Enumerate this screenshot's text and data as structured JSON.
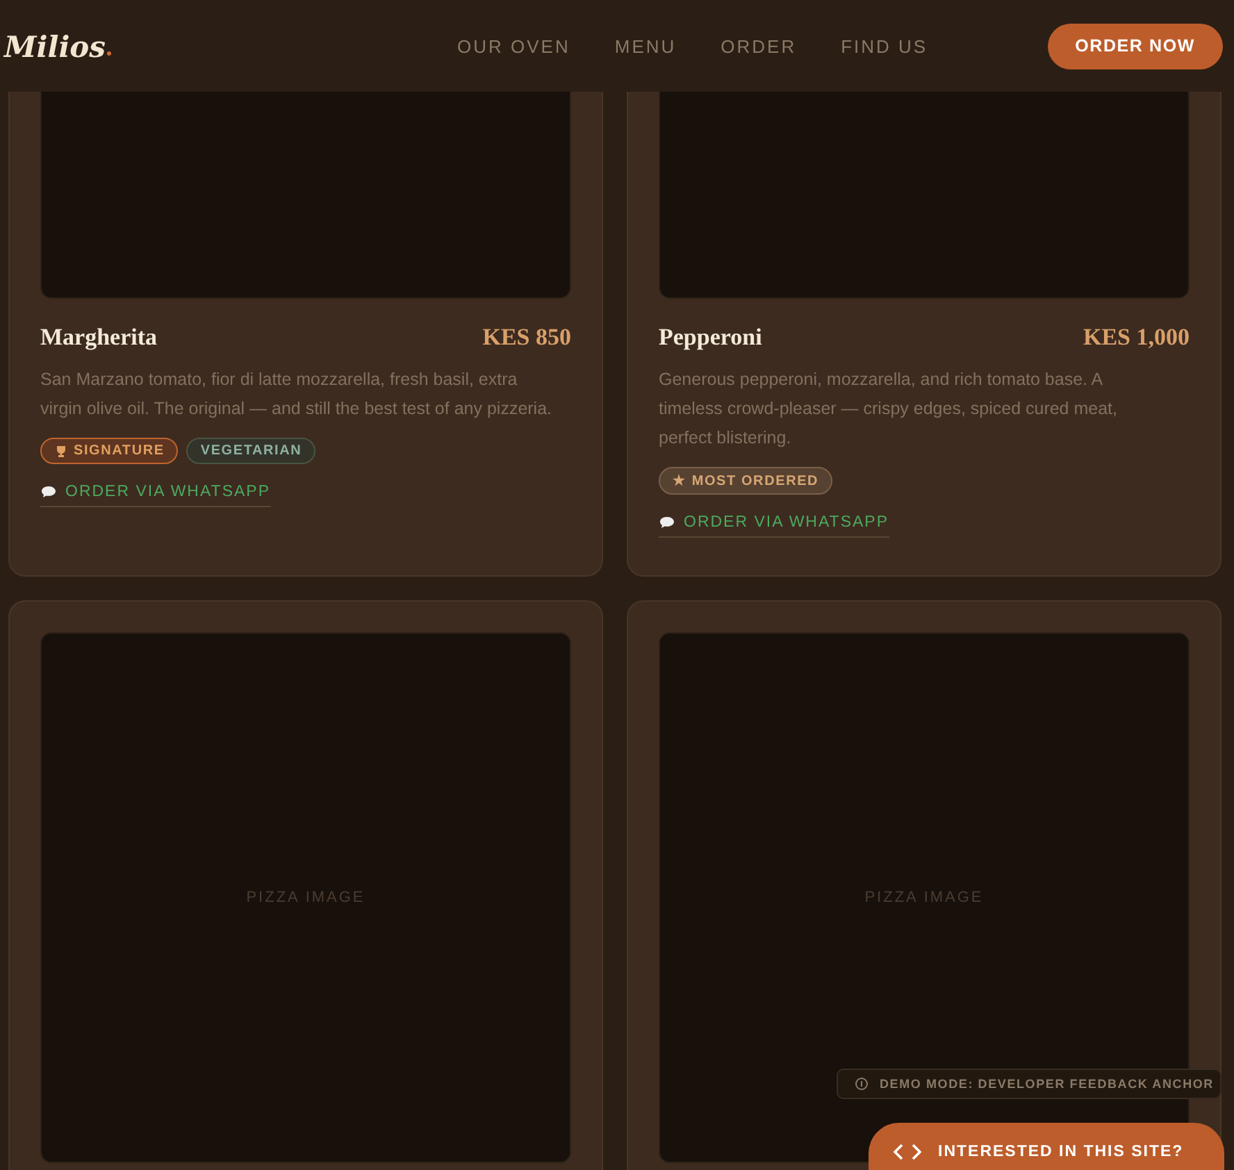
{
  "header": {
    "logo": "Milios",
    "nav": [
      {
        "label": "OUR OVEN"
      },
      {
        "label": "MENU"
      },
      {
        "label": "ORDER"
      },
      {
        "label": "FIND US"
      }
    ],
    "cta": "ORDER NOW"
  },
  "cards": [
    {
      "name": "Margherita",
      "price": "KES 850",
      "description": "San Marzano tomato, fior di latte mozzarella, fresh basil, extra virgin olive oil. The original — and still the best test of any pizzeria.",
      "tags": [
        {
          "kind": "signature",
          "label": "SIGNATURE"
        },
        {
          "kind": "vegetarian",
          "label": "VEGETARIAN"
        }
      ],
      "order_link": "ORDER VIA WHATSAPP"
    },
    {
      "name": "Pepperoni",
      "price": "KES 1,000",
      "description": "Generous pepperoni, mozzarella, and rich tomato base. A timeless crowd-pleaser — crispy edges, spiced cured meat, perfect blistering.",
      "tags": [
        {
          "kind": "popular",
          "label": "MOST ORDERED",
          "icon": "★"
        }
      ],
      "order_link": "ORDER VIA WHATSAPP"
    },
    {
      "image_label": "PIZZA IMAGE"
    },
    {
      "image_label": "PIZZA IMAGE"
    }
  ],
  "demo_notice": "DEMO MODE: DEVELOPER FEEDBACK ANCHOR",
  "interest_button": "INTERESTED IN THIS SITE?"
}
